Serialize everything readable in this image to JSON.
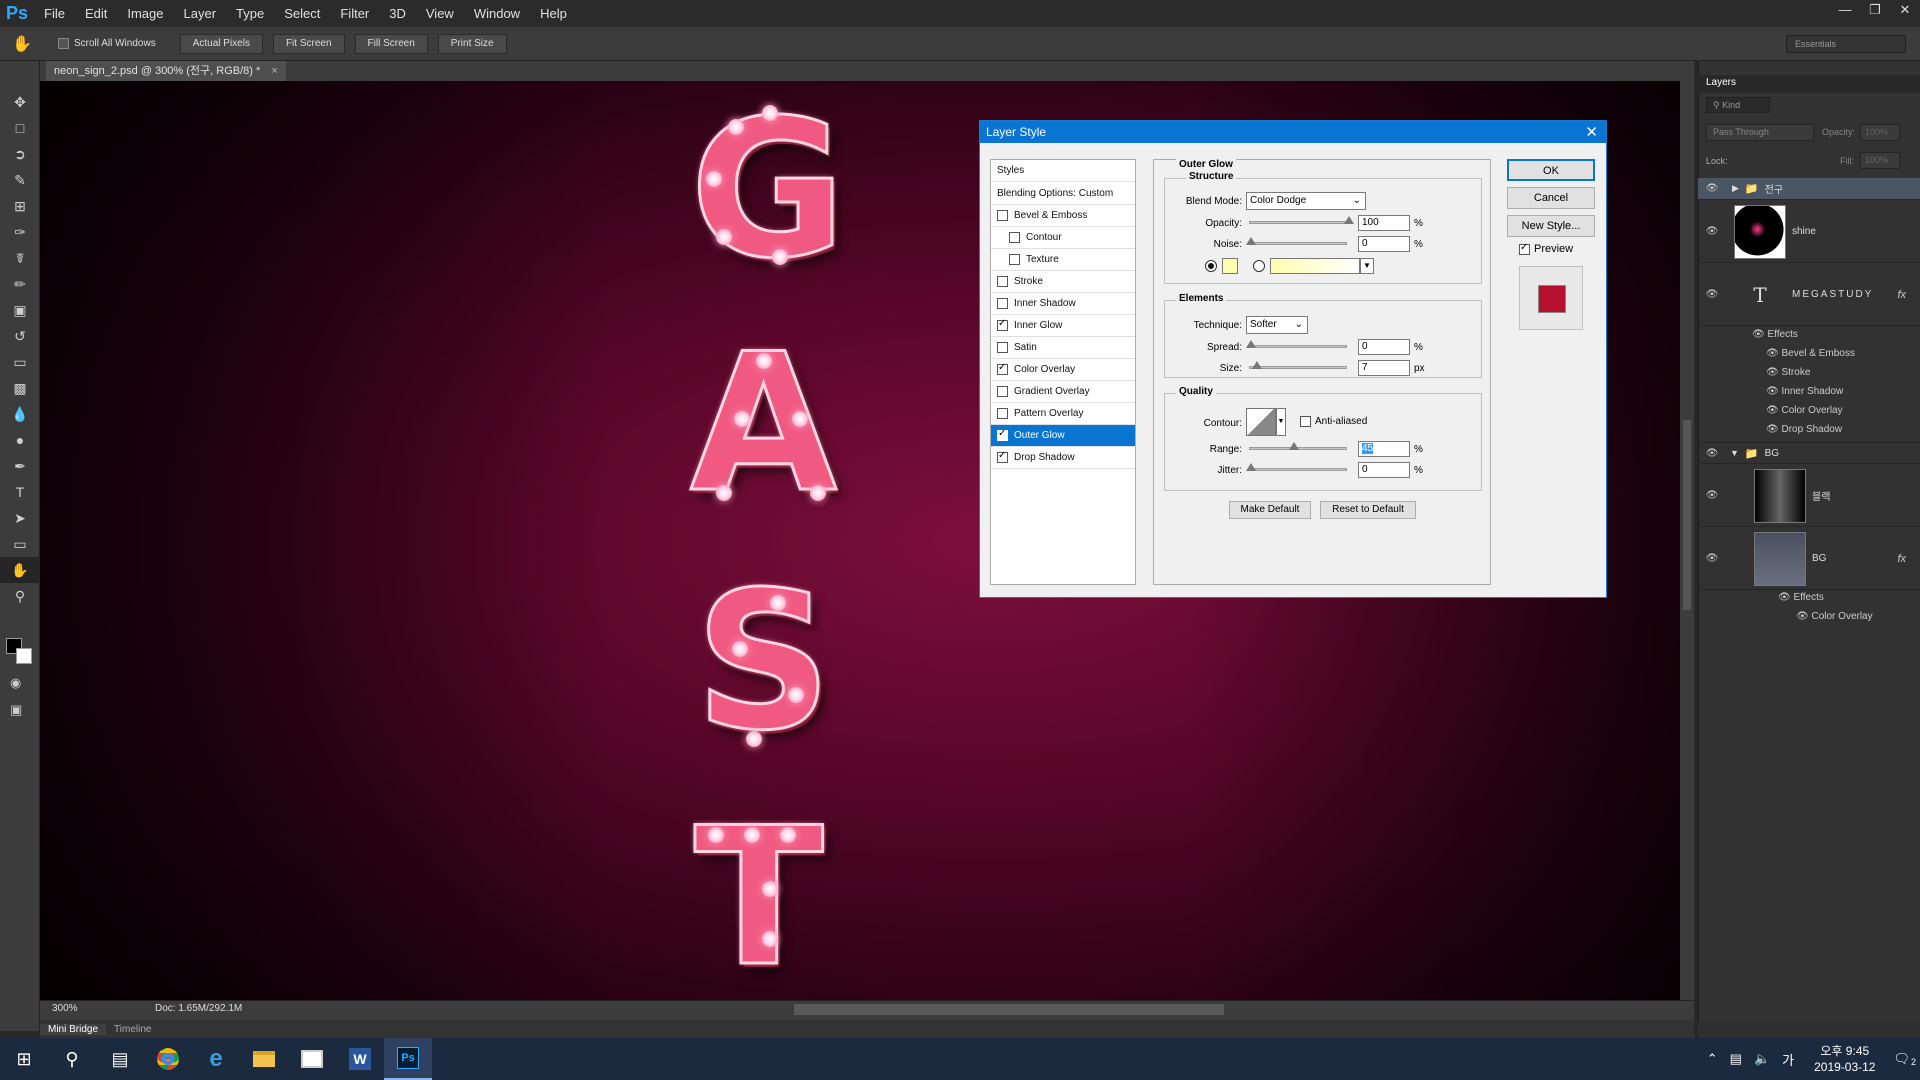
{
  "app": {
    "logo": "Ps",
    "menu": [
      "File",
      "Edit",
      "Image",
      "Layer",
      "Type",
      "Select",
      "Filter",
      "3D",
      "View",
      "Window",
      "Help"
    ],
    "window_controls": [
      "minimize-icon",
      "restore-icon",
      "close-icon"
    ]
  },
  "options_bar": {
    "tool_icon": "hand-icon",
    "scroll_all_windows": {
      "label": "Scroll All Windows",
      "checked": false
    },
    "buttons": [
      "Actual Pixels",
      "Fit Screen",
      "Fill Screen",
      "Print Size"
    ],
    "workspace": "Essentials"
  },
  "document": {
    "tab_title": "neon_sign_2.psd @ 300% (전구, RGB/8) *",
    "zoom": "300%",
    "doc_size": "Doc: 1.65M/292.1M",
    "canvas_letters": [
      "G",
      "A",
      "S",
      "T"
    ]
  },
  "bottom_tabs": [
    "Mini Bridge",
    "Timeline"
  ],
  "dialog": {
    "title": "Layer Style",
    "styles_header": "Styles",
    "blending_options": "Blending Options: Custom",
    "style_items": [
      {
        "label": "Bevel & Emboss",
        "checked": false,
        "indent": false
      },
      {
        "label": "Contour",
        "checked": false,
        "indent": true
      },
      {
        "label": "Texture",
        "checked": false,
        "indent": true
      },
      {
        "label": "Stroke",
        "checked": false,
        "indent": false
      },
      {
        "label": "Inner Shadow",
        "checked": false,
        "indent": false
      },
      {
        "label": "Inner Glow",
        "checked": true,
        "indent": false
      },
      {
        "label": "Satin",
        "checked": false,
        "indent": false
      },
      {
        "label": "Color Overlay",
        "checked": true,
        "indent": false
      },
      {
        "label": "Gradient Overlay",
        "checked": false,
        "indent": false
      },
      {
        "label": "Pattern Overlay",
        "checked": false,
        "indent": false
      },
      {
        "label": "Outer Glow",
        "checked": true,
        "indent": false,
        "selected": true
      },
      {
        "label": "Drop Shadow",
        "checked": true,
        "indent": false
      }
    ],
    "panel_title": "Outer Glow",
    "structure": {
      "title": "Structure",
      "blend_mode_label": "Blend Mode:",
      "blend_mode": "Color Dodge",
      "opacity_label": "Opacity:",
      "opacity": "100",
      "noise_label": "Noise:",
      "noise": "0",
      "unit_pct": "%",
      "glow_color": "#ffffb0"
    },
    "elements": {
      "title": "Elements",
      "technique_label": "Technique:",
      "technique": "Softer",
      "spread_label": "Spread:",
      "spread": "0",
      "size_label": "Size:",
      "size": "7",
      "unit_px": "px"
    },
    "quality": {
      "title": "Quality",
      "contour_label": "Contour:",
      "anti_aliased_label": "Anti-aliased",
      "anti_aliased": false,
      "range_label": "Range:",
      "range": "45",
      "jitter_label": "Jitter:",
      "jitter": "0"
    },
    "make_default": "Make Default",
    "reset_default": "Reset to Default",
    "ok": "OK",
    "cancel": "Cancel",
    "new_style": "New Style...",
    "preview_label": "Preview",
    "preview_checked": true,
    "preview_swatch_color": "#b5102e"
  },
  "layers_panel": {
    "title": "Layers",
    "filter_kind": "Kind",
    "blend_mode": "Pass Through",
    "opacity_label": "Opacity:",
    "opacity": "100%",
    "lock_label": "Lock:",
    "fill_label": "Fill:",
    "fill": "100%",
    "layers": [
      {
        "name": "전구",
        "type": "group",
        "selected": true
      },
      {
        "name": "shine",
        "type": "image"
      },
      {
        "name": "MEGASTUDY",
        "type": "text",
        "fx": "fx"
      },
      {
        "name": "BG",
        "type": "group"
      },
      {
        "name": "블랙",
        "type": "image"
      },
      {
        "name": "BG",
        "type": "image",
        "fx": "fx"
      }
    ],
    "megastudy_effects": [
      "Effects",
      "Bevel & Emboss",
      "Stroke",
      "Inner Shadow",
      "Color Overlay",
      "Drop Shadow"
    ],
    "bg_effects": [
      "Effects",
      "Color Overlay"
    ]
  },
  "taskbar": {
    "icons": [
      "windows-start-icon",
      "search-icon",
      "task-view-icon",
      "chrome-icon",
      "edge-icon",
      "file-explorer-icon",
      "photos-icon",
      "word-icon",
      "photoshop-icon"
    ],
    "word_label": "W",
    "ps_label": "Ps",
    "tray_time_ampm": "오후 9:45",
    "tray_date": "2019-03-12",
    "tray_ime": "가",
    "notifications_count": "2"
  }
}
